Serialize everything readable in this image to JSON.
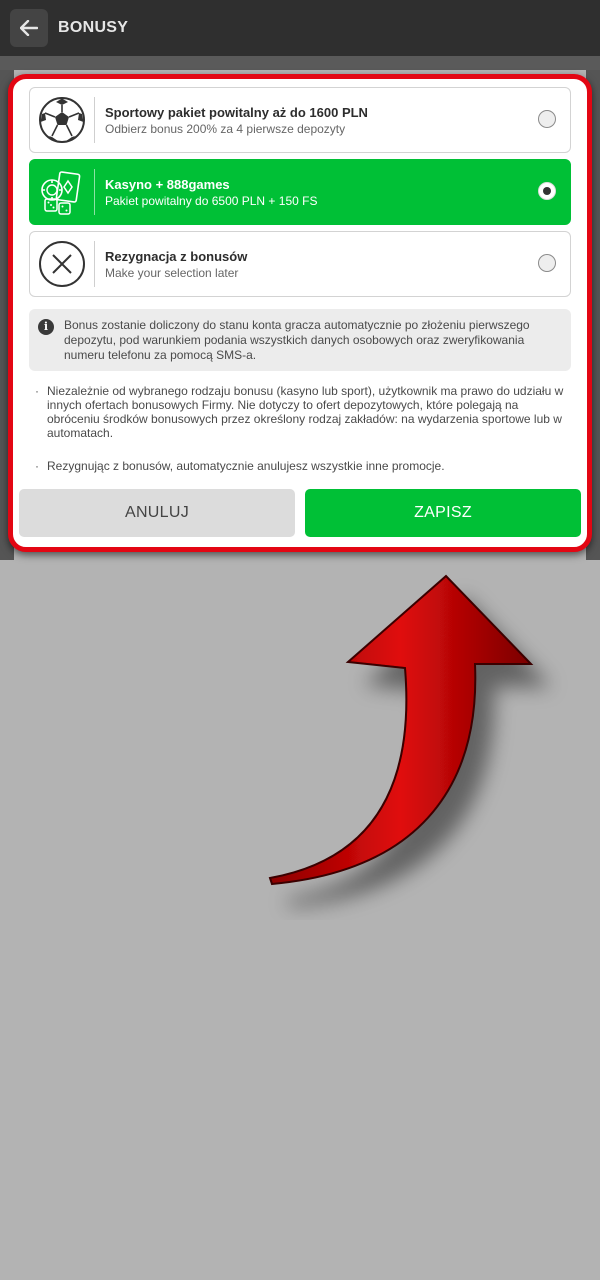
{
  "header": {
    "title": "BONUSY",
    "back_icon": "arrow-left-icon"
  },
  "options": [
    {
      "icon": "soccer-ball-icon",
      "title": "Sportowy pakiet powitalny aż do 1600 PLN",
      "subtitle": "Odbierz bonus 200% za 4 pierwsze depozyty",
      "selected": false
    },
    {
      "icon": "casino-chips-cards-icon",
      "title": "Kasyno + 888games",
      "subtitle": "Pakiet powitalny do 6500 PLN + 150 FS",
      "selected": true
    },
    {
      "icon": "close-circle-icon",
      "title": "Rezygnacja z bonusów",
      "subtitle": "Make your selection later",
      "selected": false
    }
  ],
  "info": {
    "icon": "info-icon",
    "text": "Bonus zostanie doliczony do stanu konta gracza automatycznie po złożeniu pierwszego depozytu, pod warunkiem podania wszystkich danych osobowych oraz zweryfikowania numeru telefonu za pomocą SMS-a."
  },
  "bullets": [
    "Niezależnie od wybranego rodzaju bonusu (kasyno lub sport), użytkownik ma prawo do udziału w innych ofertach bonusowych Firmy. Nie dotyczy to ofert depozytowych, które polegają na obróceniu środków bonusowych przez określony rodzaj zakładów: na wydarzenia sportowe lub w automatach.",
    "Rezygnując z bonusów, automatycznie anulujesz wszystkie inne promocje."
  ],
  "buttons": {
    "cancel": "ANULUJ",
    "save": "ZAPISZ"
  },
  "colors": {
    "accent_green": "#00c036",
    "highlight_red": "#e30613",
    "topbar": "#2f2f2f",
    "backdrop": "#b3b3b3"
  }
}
